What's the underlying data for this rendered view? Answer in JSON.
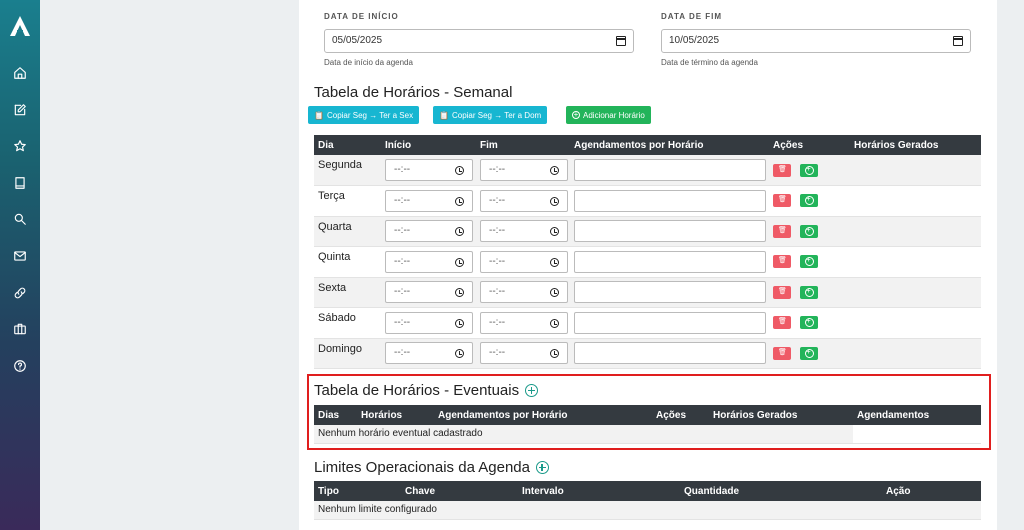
{
  "sidebar": {
    "logo": "brand-logo",
    "items": [
      {
        "name": "home-icon"
      },
      {
        "name": "edit-icon"
      },
      {
        "name": "star-icon"
      },
      {
        "name": "book-icon"
      },
      {
        "name": "search-icon"
      },
      {
        "name": "mail-icon"
      },
      {
        "name": "link-icon"
      },
      {
        "name": "briefcase-icon"
      },
      {
        "name": "help-icon"
      }
    ]
  },
  "dates": {
    "start_label": "DATA DE INÍCIO",
    "start_value": "05/05/2025",
    "start_help": "Data de início da agenda",
    "end_label": "DATA DE FIM",
    "end_value": "10/05/2025",
    "end_help": "Data de término da agenda"
  },
  "weekly": {
    "title": "Tabela de Horários - Semanal",
    "buttons": {
      "copy_mon_fri": "Copiar Seg → Ter a Sex",
      "copy_mon_sun": "Copiar Seg → Ter a Dom",
      "add_time": "Adicionar Horário"
    },
    "headers": [
      "Dia",
      "Início",
      "Fim",
      "Agendamentos por Horário",
      "Ações",
      "Horários Gerados"
    ],
    "time_placeholder": "--:--",
    "days": [
      "Segunda",
      "Terça",
      "Quarta",
      "Quinta",
      "Sexta",
      "Sábado",
      "Domingo"
    ]
  },
  "eventual": {
    "title": "Tabela de Horários - Eventuais",
    "headers": [
      "Dias",
      "Horários",
      "Agendamentos por Horário",
      "Ações",
      "Horários Gerados",
      "Agendamentos"
    ],
    "empty": "Nenhum horário eventual cadastrado"
  },
  "limits": {
    "title": "Limites Operacionais da Agenda",
    "headers": [
      "Tipo",
      "Chave",
      "Intervalo",
      "Quantidade",
      "Ação"
    ],
    "empty": "Nenhum limite configurado"
  },
  "colors": {
    "accent": "#1a9a8a",
    "info": "#17b6d1",
    "success": "#22b45a",
    "danger": "#ef5a66",
    "header_dark": "#343a40",
    "highlight": "#e01e1e"
  }
}
